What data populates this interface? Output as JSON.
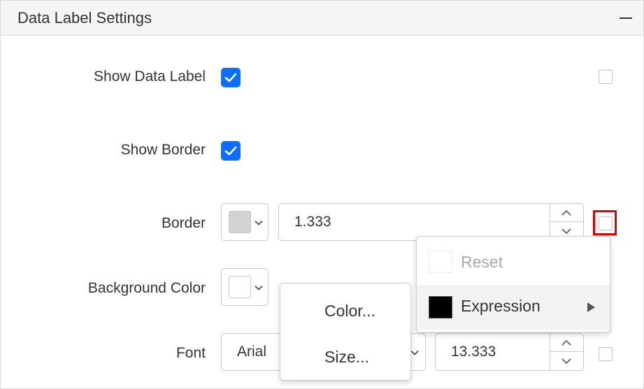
{
  "header": {
    "title": "Data Label Settings"
  },
  "rows": {
    "show_data_label": {
      "label": "Show Data Label"
    },
    "show_border": {
      "label": "Show Border"
    },
    "border": {
      "label": "Border",
      "swatch_color": "#d3d3d3",
      "width_value": "1.333"
    },
    "background_color": {
      "label": "Background Color",
      "swatch_color": "#ffffff"
    },
    "font": {
      "label": "Font",
      "family_value": "Arial",
      "size_value": "13.333"
    }
  },
  "context_menu": {
    "reset_label": "Reset",
    "expression_label": "Expression"
  },
  "submenu": {
    "items": [
      "Color...",
      "Size..."
    ]
  },
  "colors": {
    "accent": "#0d6efd",
    "highlight": "#e00000",
    "expression_swatch": "#000000"
  }
}
